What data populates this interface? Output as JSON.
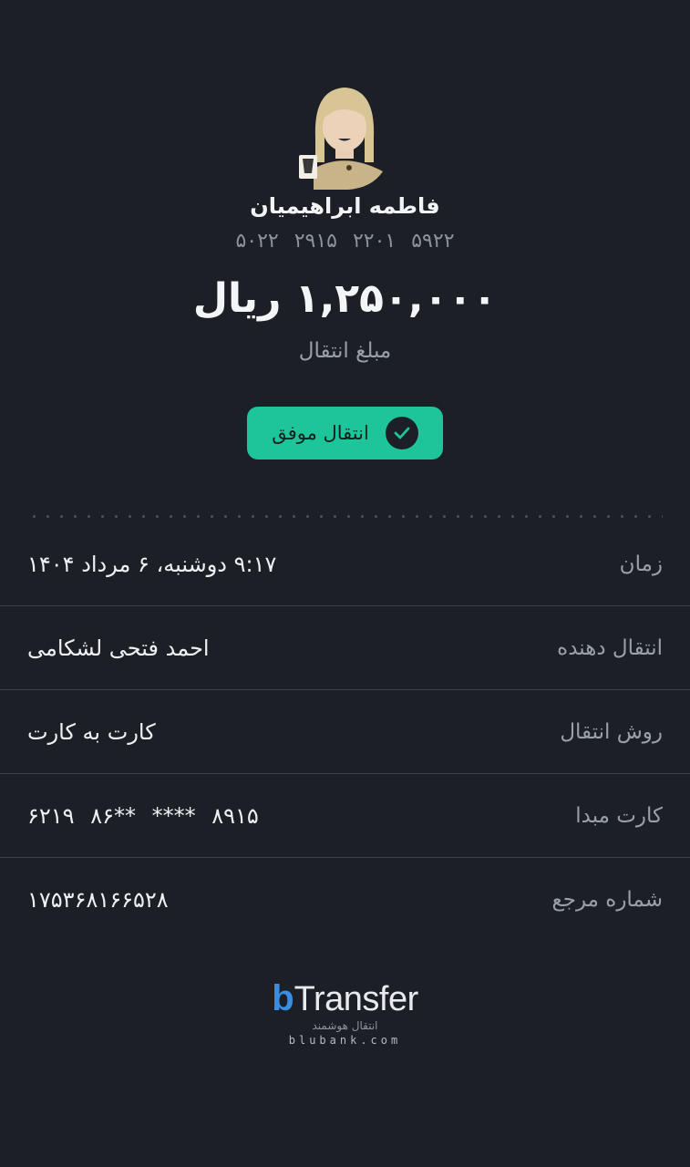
{
  "recipient": {
    "name": "فاطمه ابراهیمیان",
    "card_number": "۵۹۲۲ ۲۲۰۱ ۲۹۱۵ ۵۰۲۲"
  },
  "transfer": {
    "amount": "۱,۲۵۰,۰۰۰ ریال",
    "amount_label": "مبلغ انتقال",
    "status": "انتقال موفق"
  },
  "details": [
    {
      "label": "زمان",
      "value": "۹:۱۷ دوشنبه، ۶ مرداد ۱۴۰۴"
    },
    {
      "label": "انتقال دهنده",
      "value": "احمد فتحی لشکامی"
    },
    {
      "label": "روش انتقال",
      "value": "کارت به کارت"
    },
    {
      "label": "کارت مبدا",
      "value": "۶۲۱۹ ۸۶** **** ۸۹۱۵"
    },
    {
      "label": "شماره مرجع",
      "value": "۱۷۵۳۶۸۱۶۶۵۲۸"
    }
  ],
  "footer": {
    "logo_b": "b",
    "logo_word": "Transfer",
    "logo_tagline": "انتقال هوشمند",
    "logo_url": "blubank.com"
  },
  "colors": {
    "background": "#1c1f26",
    "success": "#1ec59a",
    "brand_blue": "#3a8de0"
  }
}
